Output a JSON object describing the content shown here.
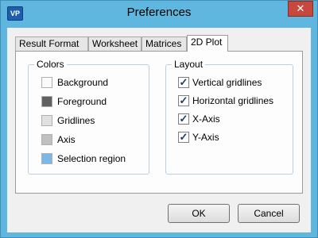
{
  "window": {
    "title": "Preferences",
    "icon_text": "VP",
    "close_glyph": "✕"
  },
  "tabs": [
    {
      "label": "Result Format",
      "active": false
    },
    {
      "label": "Worksheet",
      "active": false
    },
    {
      "label": "Matrices",
      "active": false
    },
    {
      "label": "2D Plot",
      "active": true
    }
  ],
  "colors_group": {
    "title": "Colors",
    "items": [
      {
        "label": "Background",
        "color": "#fafafa"
      },
      {
        "label": "Foreground",
        "color": "#606060"
      },
      {
        "label": "Gridlines",
        "color": "#e0e0e0"
      },
      {
        "label": "Axis",
        "color": "#c0c0c0"
      },
      {
        "label": "Selection region",
        "color": "#7cb7e8"
      }
    ]
  },
  "layout_group": {
    "title": "Layout",
    "items": [
      {
        "label": "Vertical gridlines",
        "checked": true
      },
      {
        "label": "Horizontal gridlines",
        "checked": true
      },
      {
        "label": "X-Axis",
        "checked": true
      },
      {
        "label": "Y-Axis",
        "checked": true
      }
    ],
    "check_glyph": "✓"
  },
  "buttons": {
    "ok": "OK",
    "cancel": "Cancel"
  }
}
